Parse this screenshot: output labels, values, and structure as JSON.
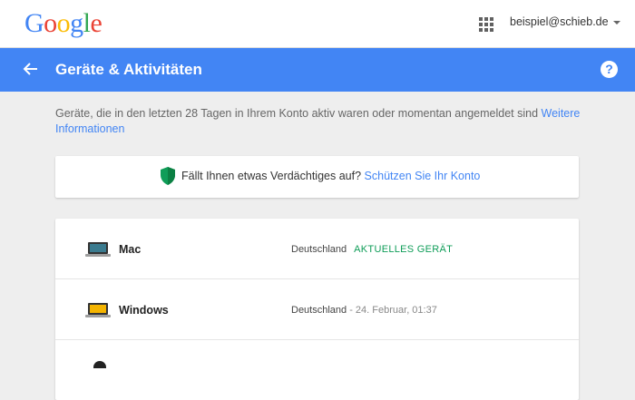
{
  "header": {
    "logo": "Google",
    "account": "beispiel@schieb.de"
  },
  "titlebar": {
    "title": "Geräte & Aktivitäten",
    "help_glyph": "?"
  },
  "intro": {
    "text": "Geräte, die in den letzten 28 Tagen in Ihrem Konto aktiv waren oder momentan angemeldet sind",
    "link": "Weitere Informationen"
  },
  "alert": {
    "text": "Fällt Ihnen etwas Verdächtiges auf?",
    "link": "Schützen Sie Ihr Konto"
  },
  "devices": [
    {
      "name": "Mac",
      "location": "Deutschland",
      "status": "AKTUELLES GERÄT",
      "icon": "laptop-icon"
    },
    {
      "name": "Windows",
      "location": "Deutschland",
      "status": " - 24. Februar, 01:37",
      "icon": "laptop-icon"
    }
  ],
  "colors": {
    "brand_blue": "#4285f4",
    "current_green": "#0f9d58",
    "shield_green": "#0f9d58"
  }
}
